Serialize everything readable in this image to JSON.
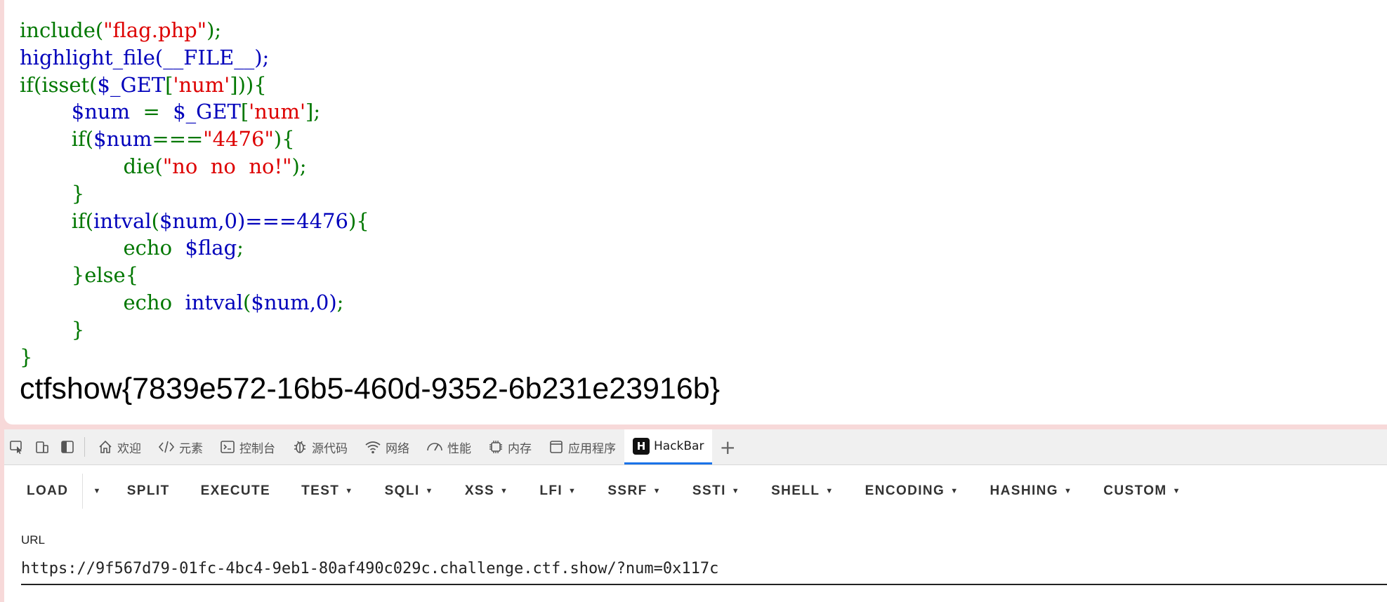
{
  "code": {
    "l1_fn": "include(",
    "l1_str": "\"flag.php\"",
    "l1_end": ");",
    "l2": "highlight_file(__FILE__);",
    "l3_if": "if(isset(",
    "l3_var": "$_GET",
    "l3_open": "[",
    "l3_key": "'num'",
    "l3_close": "])){",
    "l4_var": "$num",
    "l4_eq": "  =  ",
    "l4_get": "$_GET",
    "l4_open": "[",
    "l4_key": "'num'",
    "l4_close": "];",
    "l5_if": "if(",
    "l5_var": "$num",
    "l5_op": "===",
    "l5_str": "\"4476\"",
    "l5_end": "){",
    "l6_fn": "die(",
    "l6_str": "\"no  no  no!\"",
    "l6_end": ");",
    "l7": "}",
    "l8_if": "if(",
    "l8_fn": "intval",
    "l8_p1": "(",
    "l8_var": "$num",
    "l8_mid": ",0)===4476",
    "l8_end": "){",
    "l9_echo": "echo  ",
    "l9_var": "$flag",
    "l9_end": ";",
    "l10": "}else{",
    "l11_echo": "echo  ",
    "l11_fn": "intval",
    "l11_p1": "(",
    "l11_var": "$num",
    "l11_mid": ",0)",
    "l11_end": ";",
    "l12": "}",
    "l13": "}"
  },
  "output_flag": "ctfshow{7839e572-16b5-460d-9352-6b231e23916b}",
  "devtools": {
    "tabs": [
      {
        "label": "欢迎",
        "icon": "home-icon"
      },
      {
        "label": "元素",
        "icon": "code-icon"
      },
      {
        "label": "控制台",
        "icon": "console-icon"
      },
      {
        "label": "源代码",
        "icon": "bug-icon"
      },
      {
        "label": "网络",
        "icon": "wifi-icon"
      },
      {
        "label": "性能",
        "icon": "performance-icon"
      },
      {
        "label": "内存",
        "icon": "memory-icon"
      },
      {
        "label": "应用程序",
        "icon": "application-icon"
      },
      {
        "label": "HackBar",
        "icon": "hackbar-logo-icon",
        "active": true
      }
    ],
    "hackbar_logo_letter": "H"
  },
  "hackbar": {
    "buttons": [
      "LOAD",
      "SPLIT",
      "EXECUTE",
      "TEST",
      "SQLI",
      "XSS",
      "LFI",
      "SSRF",
      "SSTI",
      "SHELL",
      "ENCODING",
      "HASHING",
      "CUSTOM"
    ],
    "url_label": "URL",
    "url_value": "https://9f567d79-01fc-4bc4-9eb1-80af490c029c.challenge.ctf.show/?num=0x117c"
  },
  "colors": {
    "php_keyword": "#007700",
    "php_string": "#dd0000",
    "php_default": "#0000bb",
    "tab_active_underline": "#1a73e8"
  }
}
